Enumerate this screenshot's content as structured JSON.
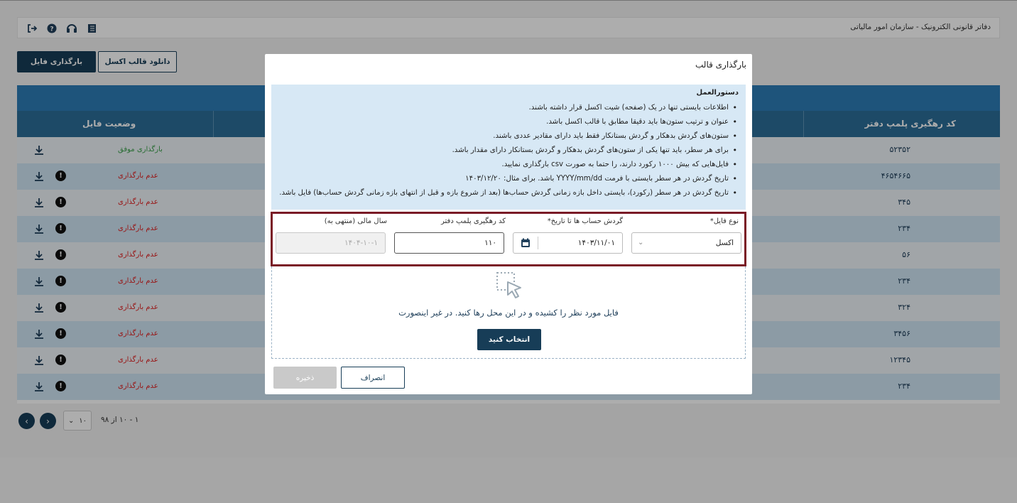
{
  "header": {
    "title": "دفاتر قانونی الکترونیک - سازمان امور مالیاتی",
    "icons": [
      "logout-icon",
      "help-icon",
      "support-icon",
      "book-icon"
    ]
  },
  "toolbar": {
    "upload_label": "بارگذاری فایل",
    "download_template_label": "دانلود قالب اکسل"
  },
  "table": {
    "columns": {
      "code": "کد رهگیری پلمپ دفتر",
      "status": "وضعیت فایل"
    },
    "rows": [
      {
        "code": "۵۲۳۵۲",
        "status": "بارگذاری موفق",
        "ok": true
      },
      {
        "code": "۴۶۵۴۶۶۵",
        "status": "عدم بارگذاری",
        "ok": false
      },
      {
        "code": "۳۴۵",
        "status": "عدم بارگذاری",
        "ok": false
      },
      {
        "code": "۲۳۴",
        "status": "عدم بارگذاری",
        "ok": false
      },
      {
        "code": "۵۶",
        "status": "عدم بارگذاری",
        "ok": false
      },
      {
        "code": "۲۳۴",
        "status": "عدم بارگذاری",
        "ok": false
      },
      {
        "code": "۳۲۴",
        "status": "عدم بارگذاری",
        "ok": false
      },
      {
        "code": "۳۴۵۶",
        "status": "عدم بارگذاری",
        "ok": false
      },
      {
        "code": "۱۲۳۴۵",
        "status": "عدم بارگذاری",
        "ok": false
      },
      {
        "code": "۲۳۴",
        "status": "عدم بارگذاری",
        "ok": false
      }
    ]
  },
  "pager": {
    "page_size": "۱۰",
    "range_text": "۱ - ۱۰ از ۹۸"
  },
  "modal": {
    "title": "بارگذاری قالب",
    "instructions_title": "دستورالعمل",
    "instructions": [
      "اطلاعات بایستی تنها در یک (صفحه) شیت اکسل قرار داشته باشند.",
      "عنوان و ترتیب ستون‌ها باید دقیقا مطابق با قالب اکسل باشد.",
      "ستون‌های گردش بدهکار و گردش بستانکار فقط باید دارای مقادیر عددی باشند.",
      "برای هر سطر، باید تنها یکی از ستون‌های گردش بدهکار و گردش بستانکار دارای مقدار باشد.",
      "فایل‌هایی که بیش ۱۰۰۰ رکورد دارند، را حتما به صورت csv بارگذاری نمایید.",
      "تاریخ گردش در هر سطر بایستی با فرمت YYYY/mm/dd باشد. برای مثال: ۱۴۰۳/۱۲/۲۰",
      "تاریخ گردش در هر سطر (رکورد)، بایستی داخل بازه زمانی گردش حساب‌ها (بعد از شروع بازه و قبل از انتهای بازه زمانی گردش حساب‌ها) فایل باشد."
    ],
    "fields": {
      "file_type_label": "نوع فایل*",
      "file_type_value": "اکسل",
      "date_label": "گردش حساب ها تا تاریخ*",
      "date_value": "۱۴۰۳/۱۱/۰۱",
      "code_label": "کد رهگیری پلمپ دفتر",
      "code_value": "۱۱۰",
      "fiscal_year_label": "سال مالی (منتهی به)",
      "fiscal_year_value": "۱۴۰۴-۱۰-۱"
    },
    "drop_text": "فایل مورد نظر را کشیده و در این محل رها کنید. در غیر اینصورت",
    "choose_label": "انتخاب کنید",
    "cancel_label": "انصراف",
    "save_label": "ذخیره"
  },
  "colors": {
    "primary": "#173d57",
    "header_blue": "#2c6d99",
    "success": "#3aa04a",
    "error": "#e02020",
    "highlight_border": "#7a1a26"
  }
}
